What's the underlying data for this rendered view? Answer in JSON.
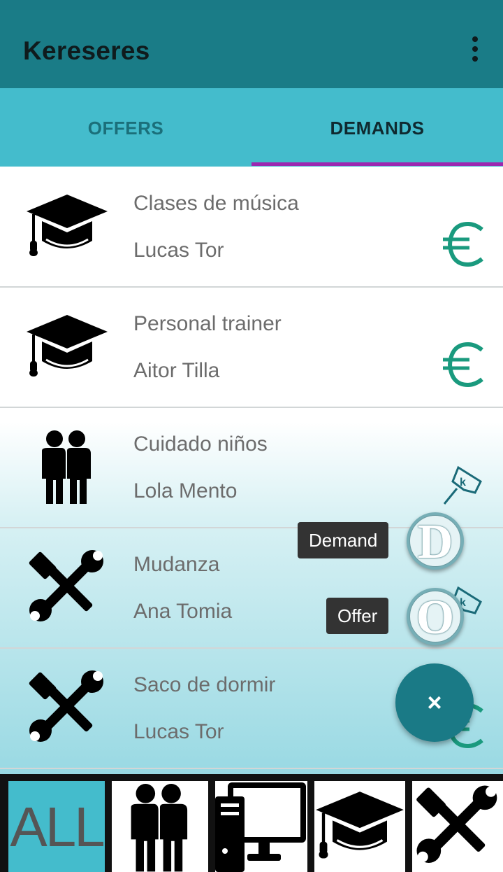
{
  "app": {
    "title": "Kereseres"
  },
  "tabs": [
    {
      "label": "OFFERS",
      "selected": false
    },
    {
      "label": "DEMANDS",
      "selected": true
    }
  ],
  "items": [
    {
      "title": "Clases de música",
      "user": "Lucas Tor",
      "icon": "graduation-cap-icon",
      "badge": "euro-icon"
    },
    {
      "title": "Personal trainer",
      "user": "Aitor Tilla",
      "icon": "graduation-cap-icon",
      "badge": "euro-icon"
    },
    {
      "title": "Cuidado niños",
      "user": "Lola Mento",
      "icon": "people-icon",
      "badge": "karma-pin-icon"
    },
    {
      "title": "Mudanza",
      "user": "Ana Tomia",
      "icon": "tools-icon",
      "badge": "karma-pin-icon"
    },
    {
      "title": "Saco de dormir",
      "user": "Lucas Tor",
      "icon": "tools-icon",
      "badge": "euro-icon"
    }
  ],
  "fab": {
    "demand_label": "Demand",
    "demand_letter": "D",
    "offer_label": "Offer",
    "offer_letter": "O",
    "close_symbol": "×"
  },
  "categories": [
    {
      "label": "ALL",
      "icon": "all-icon",
      "selected": true
    },
    {
      "icon": "people-icon"
    },
    {
      "icon": "computer-icon"
    },
    {
      "icon": "graduation-cap-icon"
    },
    {
      "icon": "tools-icon"
    }
  ],
  "colors": {
    "primary": "#1a7c87",
    "tabs_bg": "#44bccc",
    "indicator": "#9c27b0",
    "euro": "#1a9a7e",
    "pin": "#1a6a78"
  }
}
